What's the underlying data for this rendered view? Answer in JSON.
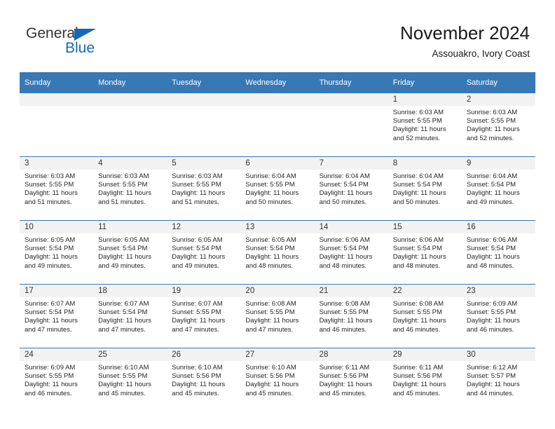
{
  "brand": {
    "name_part1": "General",
    "name_part2": "Blue",
    "logo_icon": "triangle-logo-icon",
    "accent_color": "#1668b8"
  },
  "header": {
    "title": "November 2024",
    "subtitle": "Assouakro, Ivory Coast"
  },
  "theme": {
    "header_row_bg": "#3878b5",
    "day_band_bg": "#f2f2f2",
    "row_divider": "#3878b5",
    "text_color": "#262626"
  },
  "weekday_headers": [
    "Sunday",
    "Monday",
    "Tuesday",
    "Wednesday",
    "Thursday",
    "Friday",
    "Saturday"
  ],
  "weeks": [
    [
      {
        "day": "",
        "info": ""
      },
      {
        "day": "",
        "info": ""
      },
      {
        "day": "",
        "info": ""
      },
      {
        "day": "",
        "info": ""
      },
      {
        "day": "",
        "info": ""
      },
      {
        "day": "1",
        "info": "Sunrise: 6:03 AM\nSunset: 5:55 PM\nDaylight: 11 hours\nand 52 minutes."
      },
      {
        "day": "2",
        "info": "Sunrise: 6:03 AM\nSunset: 5:55 PM\nDaylight: 11 hours\nand 52 minutes."
      }
    ],
    [
      {
        "day": "3",
        "info": "Sunrise: 6:03 AM\nSunset: 5:55 PM\nDaylight: 11 hours\nand 51 minutes."
      },
      {
        "day": "4",
        "info": "Sunrise: 6:03 AM\nSunset: 5:55 PM\nDaylight: 11 hours\nand 51 minutes."
      },
      {
        "day": "5",
        "info": "Sunrise: 6:03 AM\nSunset: 5:55 PM\nDaylight: 11 hours\nand 51 minutes."
      },
      {
        "day": "6",
        "info": "Sunrise: 6:04 AM\nSunset: 5:55 PM\nDaylight: 11 hours\nand 50 minutes."
      },
      {
        "day": "7",
        "info": "Sunrise: 6:04 AM\nSunset: 5:54 PM\nDaylight: 11 hours\nand 50 minutes."
      },
      {
        "day": "8",
        "info": "Sunrise: 6:04 AM\nSunset: 5:54 PM\nDaylight: 11 hours\nand 50 minutes."
      },
      {
        "day": "9",
        "info": "Sunrise: 6:04 AM\nSunset: 5:54 PM\nDaylight: 11 hours\nand 49 minutes."
      }
    ],
    [
      {
        "day": "10",
        "info": "Sunrise: 6:05 AM\nSunset: 5:54 PM\nDaylight: 11 hours\nand 49 minutes."
      },
      {
        "day": "11",
        "info": "Sunrise: 6:05 AM\nSunset: 5:54 PM\nDaylight: 11 hours\nand 49 minutes."
      },
      {
        "day": "12",
        "info": "Sunrise: 6:05 AM\nSunset: 5:54 PM\nDaylight: 11 hours\nand 49 minutes."
      },
      {
        "day": "13",
        "info": "Sunrise: 6:05 AM\nSunset: 5:54 PM\nDaylight: 11 hours\nand 48 minutes."
      },
      {
        "day": "14",
        "info": "Sunrise: 6:06 AM\nSunset: 5:54 PM\nDaylight: 11 hours\nand 48 minutes."
      },
      {
        "day": "15",
        "info": "Sunrise: 6:06 AM\nSunset: 5:54 PM\nDaylight: 11 hours\nand 48 minutes."
      },
      {
        "day": "16",
        "info": "Sunrise: 6:06 AM\nSunset: 5:54 PM\nDaylight: 11 hours\nand 48 minutes."
      }
    ],
    [
      {
        "day": "17",
        "info": "Sunrise: 6:07 AM\nSunset: 5:54 PM\nDaylight: 11 hours\nand 47 minutes."
      },
      {
        "day": "18",
        "info": "Sunrise: 6:07 AM\nSunset: 5:54 PM\nDaylight: 11 hours\nand 47 minutes."
      },
      {
        "day": "19",
        "info": "Sunrise: 6:07 AM\nSunset: 5:55 PM\nDaylight: 11 hours\nand 47 minutes."
      },
      {
        "day": "20",
        "info": "Sunrise: 6:08 AM\nSunset: 5:55 PM\nDaylight: 11 hours\nand 47 minutes."
      },
      {
        "day": "21",
        "info": "Sunrise: 6:08 AM\nSunset: 5:55 PM\nDaylight: 11 hours\nand 46 minutes."
      },
      {
        "day": "22",
        "info": "Sunrise: 6:08 AM\nSunset: 5:55 PM\nDaylight: 11 hours\nand 46 minutes."
      },
      {
        "day": "23",
        "info": "Sunrise: 6:09 AM\nSunset: 5:55 PM\nDaylight: 11 hours\nand 46 minutes."
      }
    ],
    [
      {
        "day": "24",
        "info": "Sunrise: 6:09 AM\nSunset: 5:55 PM\nDaylight: 11 hours\nand 46 minutes."
      },
      {
        "day": "25",
        "info": "Sunrise: 6:10 AM\nSunset: 5:55 PM\nDaylight: 11 hours\nand 45 minutes."
      },
      {
        "day": "26",
        "info": "Sunrise: 6:10 AM\nSunset: 5:56 PM\nDaylight: 11 hours\nand 45 minutes."
      },
      {
        "day": "27",
        "info": "Sunrise: 6:10 AM\nSunset: 5:56 PM\nDaylight: 11 hours\nand 45 minutes."
      },
      {
        "day": "28",
        "info": "Sunrise: 6:11 AM\nSunset: 5:56 PM\nDaylight: 11 hours\nand 45 minutes."
      },
      {
        "day": "29",
        "info": "Sunrise: 6:11 AM\nSunset: 5:56 PM\nDaylight: 11 hours\nand 45 minutes."
      },
      {
        "day": "30",
        "info": "Sunrise: 6:12 AM\nSunset: 5:57 PM\nDaylight: 11 hours\nand 44 minutes."
      }
    ]
  ]
}
